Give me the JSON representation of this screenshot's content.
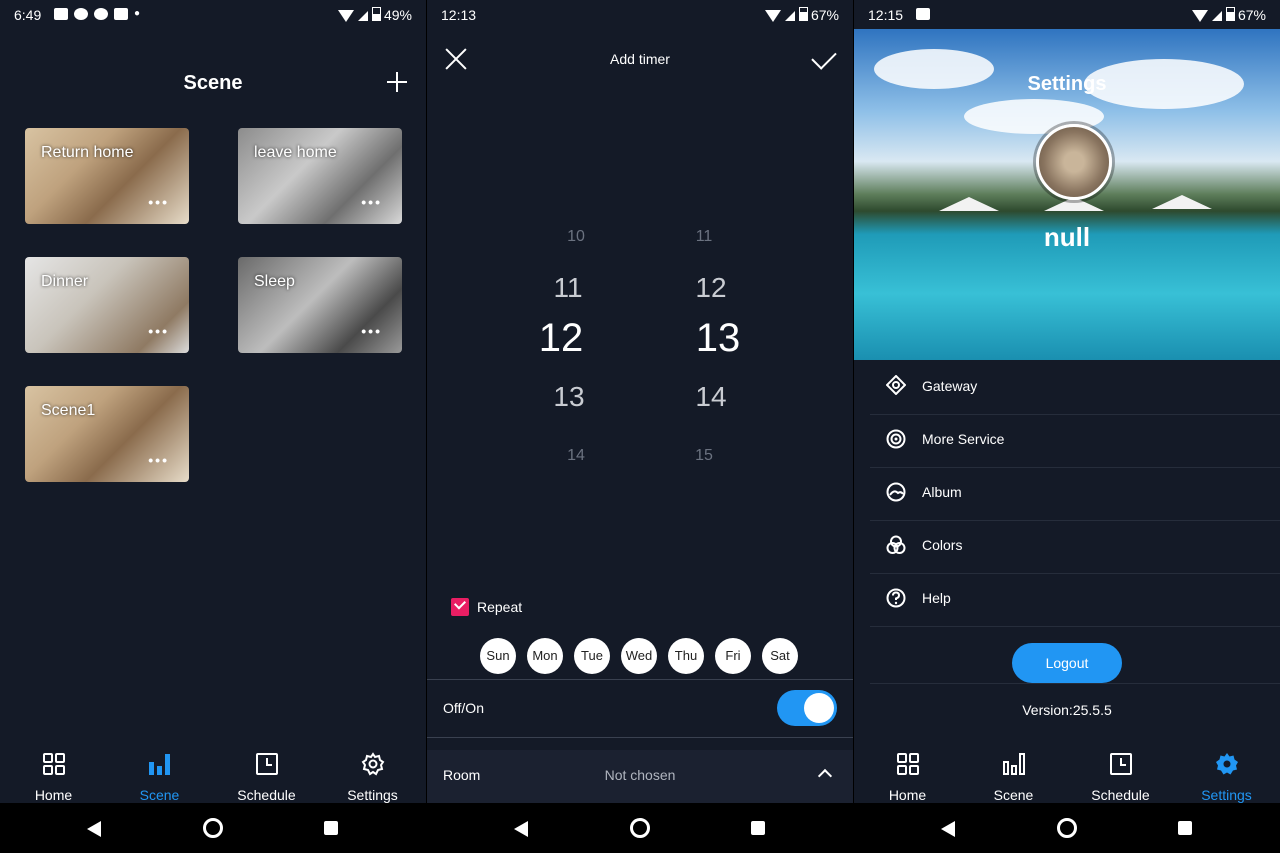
{
  "panel1": {
    "status": {
      "time": "6:49",
      "battery": "49%"
    },
    "title": "Scene",
    "scenes": [
      {
        "label": "Return home"
      },
      {
        "label": "leave home"
      },
      {
        "label": "Dinner"
      },
      {
        "label": "Sleep"
      },
      {
        "label": "Scene1"
      }
    ],
    "more": "•••",
    "tabs": [
      {
        "label": "Home",
        "icon": "grid-icon"
      },
      {
        "label": "Scene",
        "icon": "bar-chart-icon"
      },
      {
        "label": "Schedule",
        "icon": "clock-icon"
      },
      {
        "label": "Settings",
        "icon": "gear-icon"
      }
    ],
    "active_tab": "Scene"
  },
  "panel2": {
    "status": {
      "time": "12:13",
      "battery": "67%"
    },
    "title": "Add timer",
    "hours": [
      "10",
      "11",
      "12",
      "13",
      "14"
    ],
    "minutes": [
      "11",
      "12",
      "13",
      "14",
      "15"
    ],
    "repeat_label": "Repeat",
    "repeat_checked": true,
    "days": [
      "Sun",
      "Mon",
      "Tue",
      "Wed",
      "Thu",
      "Fri",
      "Sat"
    ],
    "offon_label": "Off/On",
    "offon_value": true,
    "room_label": "Room",
    "room_value": "Not chosen"
  },
  "panel3": {
    "status": {
      "time": "12:15",
      "battery": "67%"
    },
    "title": "Settings",
    "username": "null",
    "menu": [
      {
        "label": "Gateway",
        "icon": "gateway-icon"
      },
      {
        "label": "More Service",
        "icon": "target-icon"
      },
      {
        "label": "Album",
        "icon": "album-icon"
      },
      {
        "label": "Colors",
        "icon": "colors-icon"
      },
      {
        "label": "Help",
        "icon": "help-icon"
      }
    ],
    "logout_label": "Logout",
    "version": "Version:25.5.5",
    "tabs": [
      {
        "label": "Home",
        "icon": "grid-icon"
      },
      {
        "label": "Scene",
        "icon": "bar-chart-icon"
      },
      {
        "label": "Schedule",
        "icon": "clock-icon"
      },
      {
        "label": "Settings",
        "icon": "gear-icon"
      }
    ],
    "active_tab": "Settings"
  },
  "colors": {
    "accent": "#2196f3",
    "background": "#141a27",
    "checkbox": "#e91e63"
  }
}
